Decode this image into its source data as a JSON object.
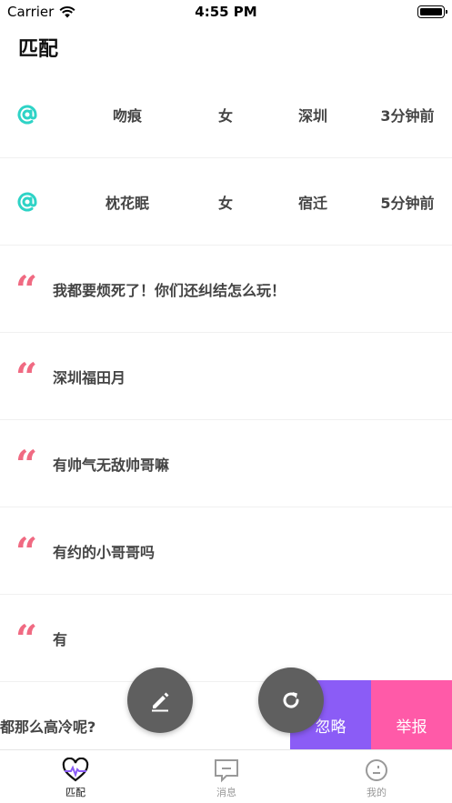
{
  "status_bar": {
    "carrier": "Carrier",
    "time": "4:55 PM"
  },
  "header": {
    "title": "匹配"
  },
  "colors": {
    "accent_teal": "#2ed3c6",
    "quote_pink": "#f06a82",
    "ignore_purple": "#8b5cf6",
    "report_pink": "#ff5aa8",
    "fab_gray": "#5f5f5f"
  },
  "users": [
    {
      "icon": "at-icon",
      "name": "吻痕",
      "gender": "女",
      "city": "深圳",
      "time": "3分钟前"
    },
    {
      "icon": "at-icon",
      "name": "枕花眠",
      "gender": "女",
      "city": "宿迁",
      "time": "5分钟前"
    }
  ],
  "messages": [
    {
      "icon": "quote-icon",
      "text": "我都要烦死了！你们还纠结怎么玩！"
    },
    {
      "icon": "quote-icon",
      "text": "深圳福田月"
    },
    {
      "icon": "quote-icon",
      "text": "有帅气无敌帅哥嘛"
    },
    {
      "icon": "quote-icon",
      "text": "有约的小哥哥吗"
    },
    {
      "icon": "quote-icon",
      "text": "有"
    }
  ],
  "swiped_row": {
    "text": "都那么高冷呢?",
    "ignore_label": "忽略",
    "report_label": "举报"
  },
  "fabs": {
    "edit_icon": "pencil-icon",
    "refresh_icon": "refresh-icon"
  },
  "tabs": [
    {
      "label": "匹配",
      "icon": "heart-pulse-icon",
      "active": true
    },
    {
      "label": "消息",
      "icon": "message-icon",
      "active": false
    },
    {
      "label": "我的",
      "icon": "profile-icon",
      "active": false
    }
  ]
}
